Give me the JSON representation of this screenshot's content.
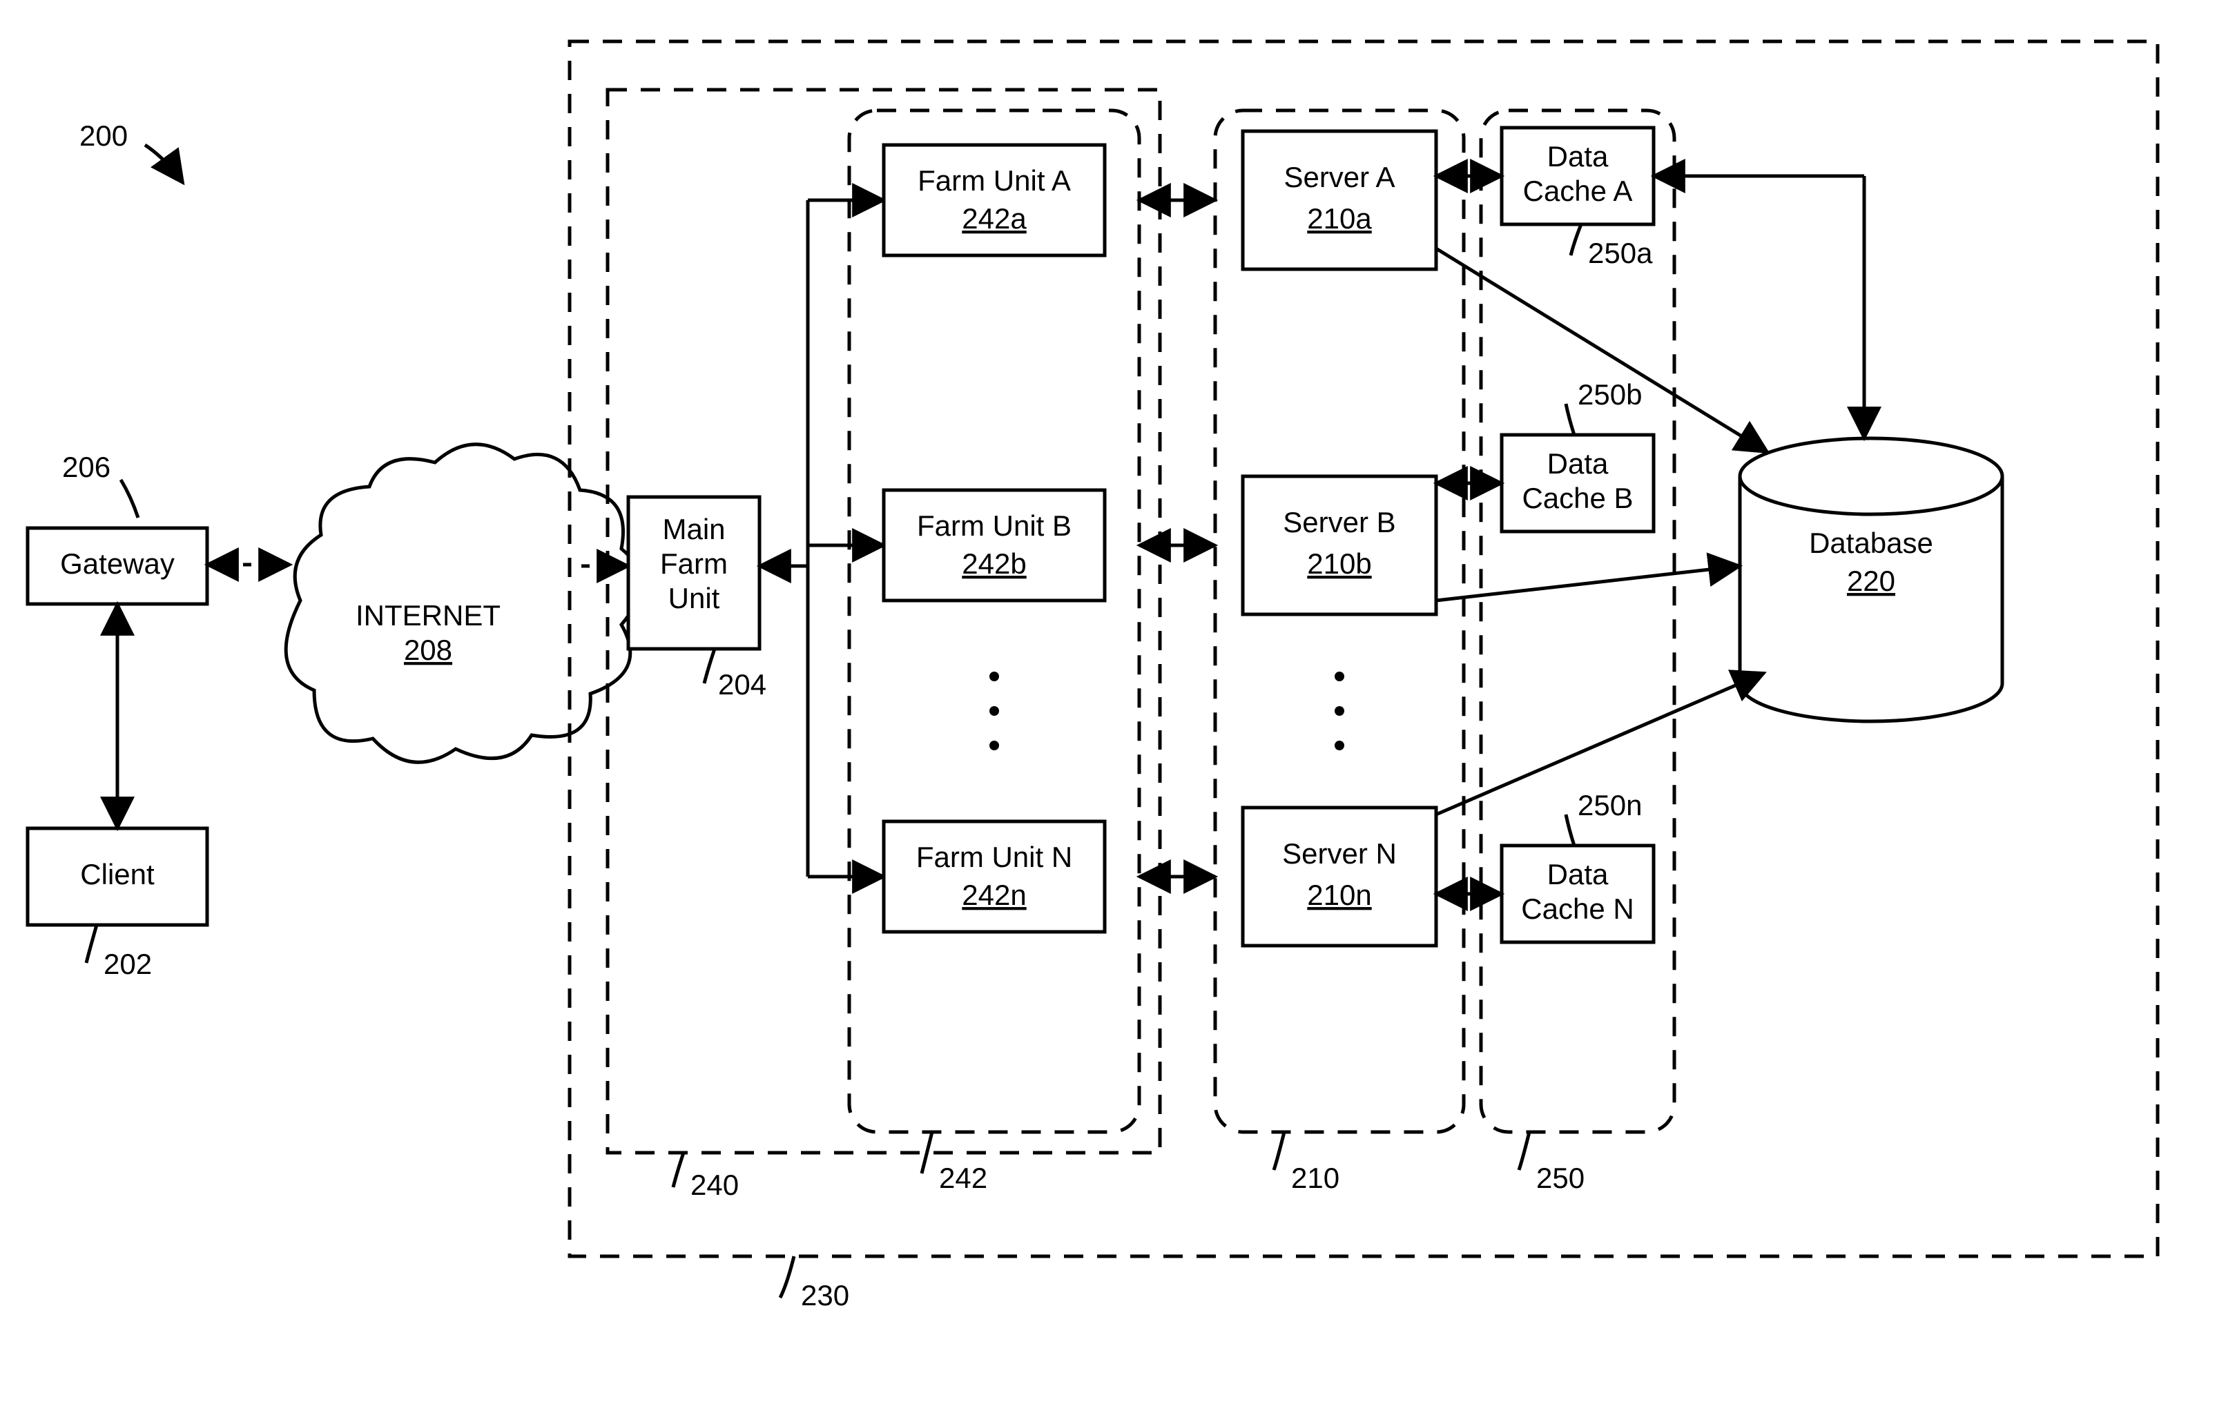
{
  "fig_ref": "200",
  "gateway": {
    "label": "Gateway",
    "ref": "206"
  },
  "client": {
    "label": "Client",
    "ref": "202"
  },
  "internet": {
    "label": "INTERNET",
    "ref": "208"
  },
  "outer_dash": {
    "ref": "230"
  },
  "farm_group": {
    "ref": "240"
  },
  "main_farm": {
    "l1": "Main",
    "l2": "Farm",
    "l3": "Unit",
    "ref": "204"
  },
  "farm_col": {
    "ref": "242"
  },
  "farm_a": {
    "label": "Farm Unit A",
    "ref": "242a"
  },
  "farm_b": {
    "label": "Farm Unit B",
    "ref": "242b"
  },
  "farm_n": {
    "label": "Farm Unit N",
    "ref": "242n"
  },
  "server_col": {
    "ref": "210"
  },
  "server_a": {
    "label": "Server A",
    "ref": "210a"
  },
  "server_b": {
    "label": "Server B",
    "ref": "210b"
  },
  "server_n": {
    "label": "Server N",
    "ref": "210n"
  },
  "cache_col": {
    "ref": "250"
  },
  "cache_a": {
    "l1": "Data",
    "l2": "Cache A",
    "ref": "250a"
  },
  "cache_b": {
    "l1": "Data",
    "l2": "Cache B",
    "ref": "250b"
  },
  "cache_n": {
    "l1": "Data",
    "l2": "Cache N",
    "ref": "250n"
  },
  "database": {
    "label": "Database",
    "ref": "220"
  }
}
